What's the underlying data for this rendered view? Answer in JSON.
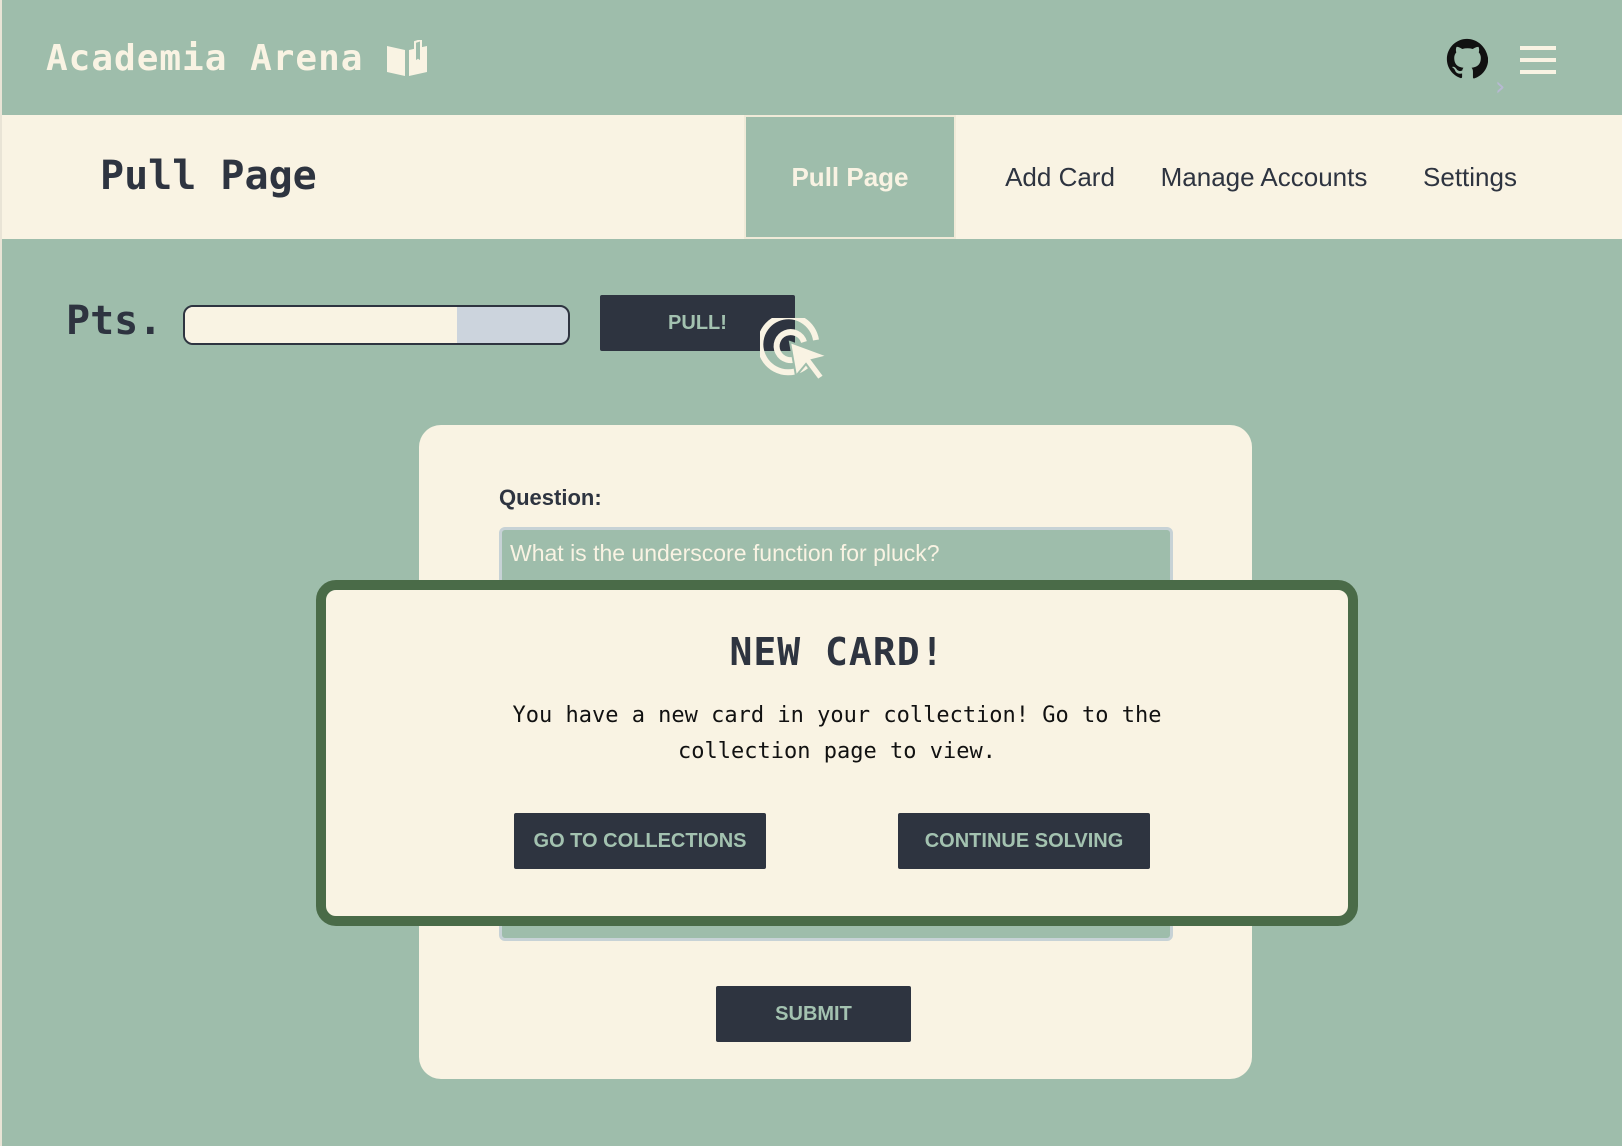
{
  "app": {
    "title": "Academia Arena",
    "icons": {
      "brand": "open-book-icon",
      "github": "github-icon",
      "menu": "hamburger-menu-icon",
      "chevron": "chevron-right-icon"
    }
  },
  "subbar": {
    "page_title": "Pull Page",
    "tabs": [
      {
        "label": "Pull Page",
        "active": true
      },
      {
        "label": "Add Card",
        "active": false
      },
      {
        "label": "Manage Accounts",
        "active": false
      },
      {
        "label": "Settings",
        "active": false
      }
    ]
  },
  "points": {
    "label": "Pts.",
    "progress": 0.71,
    "pull_label": "PULL!",
    "pull_icon": "click-cursor-icon"
  },
  "question_card": {
    "question_label": "Question:",
    "question_value": "What is the underscore function for pluck?",
    "submit_label": "SUBMIT"
  },
  "modal": {
    "title": "NEW CARD!",
    "message": "You have a new card in your collection! Go to the collection page to view.",
    "primary_label": "GO TO COLLECTIONS",
    "secondary_label": "CONTINUE SOLVING"
  },
  "colors": {
    "background": "#9ebdab",
    "cream": "#f9f3e3",
    "dark": "#2e3440",
    "modal_border": "#4a6b48"
  }
}
